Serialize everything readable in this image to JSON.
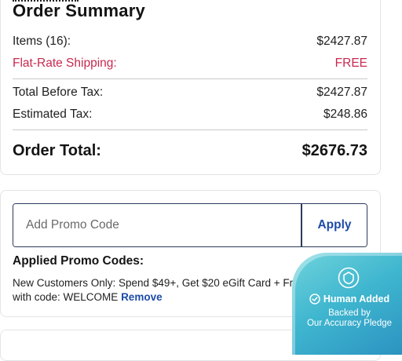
{
  "summary": {
    "title": "Order Summary",
    "items_label": "Items (16):",
    "items_value": "$2427.87",
    "shipping_label": "Flat-Rate Shipping:",
    "shipping_value": "FREE",
    "before_tax_label": "Total Before Tax:",
    "before_tax_value": "$2427.87",
    "tax_label": "Estimated Tax:",
    "tax_value": "$248.86",
    "total_label": "Order Total:",
    "total_value": "$2676.73"
  },
  "promo": {
    "placeholder": "Add Promo Code",
    "apply_label": "Apply",
    "applied_title": "Applied Promo Codes:",
    "applied_text": "New Customers Only: Spend $49+, Get $20 eGift Card + Free Shipping with code: WELCOME",
    "remove_label": "Remove"
  },
  "badge": {
    "line1": "Human Added",
    "line2": "Backed by",
    "line3": "Our Accuracy Pledge",
    "icon": "shield-icon"
  },
  "colors": {
    "shipping": "#c8294f",
    "link": "#1d4ba8",
    "badge": "#3fb6cf"
  }
}
